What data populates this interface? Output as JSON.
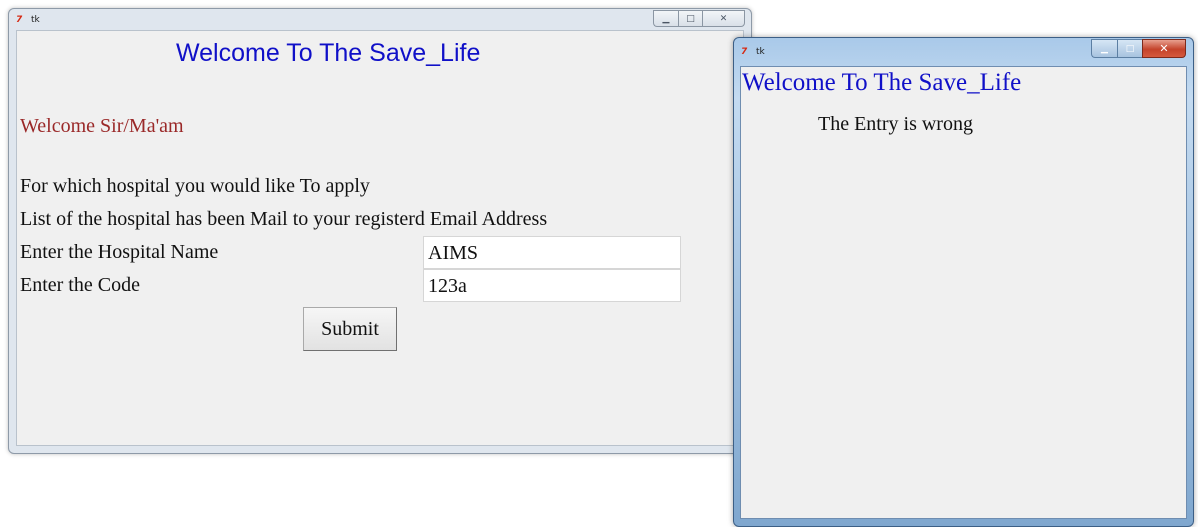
{
  "window_main": {
    "title": "tk",
    "icon": "tk-feather-icon",
    "heading": "Welcome To The Save_Life",
    "welcome": "Welcome Sir/Ma'am",
    "question": "For which hospital you would like To apply",
    "mail_note": "List of the hospital has been Mail to your registerd Email Address",
    "hospital_label": "Enter the Hospital Name",
    "hospital_value": "AIMS",
    "code_label": "Enter the Code",
    "code_value": "123a",
    "submit_label": "Submit",
    "controls": {
      "minimize": "minimize-icon",
      "maximize": "maximize-icon",
      "close": "close-icon"
    }
  },
  "window_popup": {
    "title": "tk",
    "icon": "tk-feather-icon",
    "heading": "Welcome To The Save_Life",
    "message": "The Entry is wrong",
    "controls": {
      "minimize": "minimize-icon",
      "maximize": "maximize-icon",
      "close": "close-icon"
    }
  },
  "colors": {
    "heading": "#1010c8",
    "welcome_text": "#9a2828",
    "client_bg": "#f0f0f0",
    "active_frame": "#a9c9e9",
    "inactive_frame": "#dfe6ee",
    "close_button": "#c4432b"
  }
}
